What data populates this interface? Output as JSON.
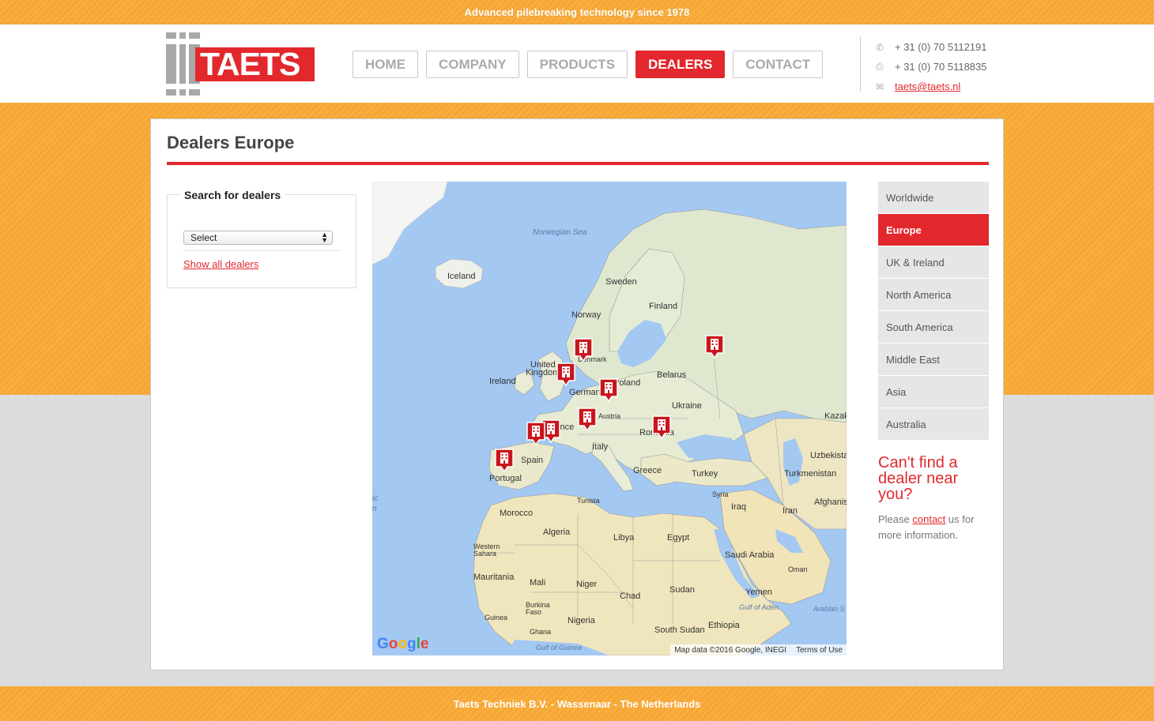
{
  "topbar": {
    "tagline": "Advanced pilebreaking technology since 1978"
  },
  "logo": {
    "text": "TAETS"
  },
  "nav": [
    {
      "label": "HOME",
      "active": false
    },
    {
      "label": "COMPANY",
      "active": false
    },
    {
      "label": "PRODUCTS",
      "active": false
    },
    {
      "label": "DEALERS",
      "active": true
    },
    {
      "label": "CONTACT",
      "active": false
    }
  ],
  "contact": {
    "phone": "+ 31 (0) 70 5112191",
    "fax": "+ 31 (0) 70 5118835",
    "email": "taets@taets.nl"
  },
  "page": {
    "title": "Dealers Europe"
  },
  "search": {
    "legend": "Search for dealers",
    "select_value": "Select",
    "show_all": "Show all dealers"
  },
  "map": {
    "labels": {
      "norwegian_sea": "Norwegian Sea",
      "iceland": "Iceland",
      "sweden": "Sweden",
      "finland": "Finland",
      "norway": "Norway",
      "denmark": "Denmark",
      "united": "United",
      "kingdom": "Kingdom",
      "ireland": "Ireland",
      "belarus": "Belarus",
      "germany": "Germany",
      "poland": "Poland",
      "ukraine": "Ukraine",
      "austria": "Austria",
      "france": "France",
      "romania": "Romania",
      "kazak": "Kazak",
      "italy": "Italy",
      "spain": "Spain",
      "portugal": "Portugal",
      "uzbekista": "Uzbekista",
      "greece": "Greece",
      "turkey": "Turkey",
      "turkmenistan": "Turkmenistan",
      "syria": "Syria",
      "tunisia": "Tunisia",
      "iraq": "Iraq",
      "afghanis": "Afghanis",
      "morocco": "Morocco",
      "iran": "Iran",
      "algeria": "Algeria",
      "libya": "Libya",
      "egypt": "Egypt",
      "western_sahara": "Western\nSahara",
      "saudi_arabia": "Saudi Arabia",
      "oman": "Oman",
      "mauritania": "Mauritania",
      "mali": "Mali",
      "niger": "Niger",
      "chad": "Chad",
      "sudan": "Sudan",
      "yemen": "Yemen",
      "gulf_of_aden": "Gulf of Aden",
      "arabian_sea": "Arabian S",
      "burkina_faso": "Burkina\nFaso",
      "guinea": "Guinea",
      "nigeria": "Nigeria",
      "ghana": "Ghana",
      "south_sudan": "South Sudan",
      "ethiopia": "Ethiopia",
      "gulf_of_guinea": "Gulf of Guinea",
      "atlantic": "ic\nn"
    },
    "google": "Google",
    "attribution": "Map data ©2016 Google, INEGI",
    "terms": "Terms of Use",
    "colors": {
      "water": "#a3c8f2",
      "land": "#e9ecd6",
      "marker": "#c8161d"
    }
  },
  "regions": [
    {
      "label": "Worldwide",
      "active": false
    },
    {
      "label": "Europe",
      "active": true
    },
    {
      "label": "UK & Ireland",
      "active": false
    },
    {
      "label": "North America",
      "active": false
    },
    {
      "label": "South America",
      "active": false
    },
    {
      "label": "Middle East",
      "active": false
    },
    {
      "label": "Asia",
      "active": false
    },
    {
      "label": "Australia",
      "active": false
    }
  ],
  "cta": {
    "heading": "Can't find a dealer near you?",
    "text_before": "Please ",
    "link": "contact",
    "text_after": " us for more information."
  },
  "footer": {
    "text": "Taets Techniek B.V. - Wassenaar - The Netherlands"
  },
  "colors": {
    "accent": "#e2282d",
    "orange": "#f7a733",
    "gray_bg": "#dcdcdc"
  }
}
